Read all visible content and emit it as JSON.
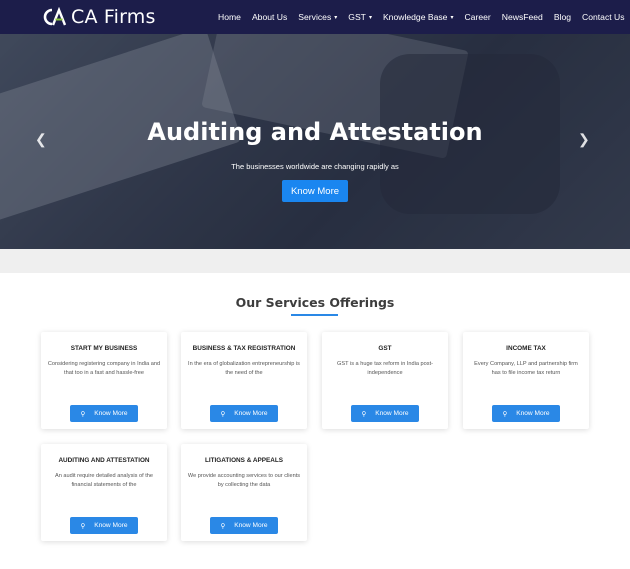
{
  "brand": {
    "name": "CA Firms",
    "logo_letters": "CA"
  },
  "nav": [
    {
      "label": "Home",
      "caret": false
    },
    {
      "label": "About Us",
      "caret": false
    },
    {
      "label": "Services",
      "caret": true
    },
    {
      "label": "GST",
      "caret": true
    },
    {
      "label": "Knowledge Base",
      "caret": true
    },
    {
      "label": "Career",
      "caret": false
    },
    {
      "label": "NewsFeed",
      "caret": false
    },
    {
      "label": "Blog",
      "caret": false
    },
    {
      "label": "Contact Us",
      "caret": false
    }
  ],
  "hero": {
    "title": "Auditing and Attestation",
    "subtitle": "The businesses worldwide are changing rapidly as",
    "button": "Know More",
    "prev_icon": "chevron-left-icon",
    "next_icon": "chevron-right-icon"
  },
  "services": {
    "heading": "Our Services Offerings",
    "accent": "#2a88e6",
    "cards": [
      {
        "title": "START MY BUSINESS",
        "text": "Considering registering company in India and that too in a fast and hassle-free",
        "button": "Know More"
      },
      {
        "title": "BUSINESS & TAX REGISTRATION",
        "text": "In the era of globalization entrepreneurship is the need of the",
        "button": "Know More"
      },
      {
        "title": "GST",
        "text": "GST is a huge tax reform in India post-independence",
        "button": "Know More"
      },
      {
        "title": "INCOME TAX",
        "text": "Every Company, LLP and partnership firm has to file income tax return",
        "button": "Know More"
      },
      {
        "title": "AUDITING AND ATTESTATION",
        "text": "An audit require detailed analysis of the financial statements of the",
        "button": "Know More"
      },
      {
        "title": "LITIGATIONS & APPEALS",
        "text": "We provide accounting services to our clients by collecting the data",
        "button": "Know More"
      }
    ]
  },
  "colors": {
    "header_bg": "#1c1d4a",
    "button_blue": "#1a86f0",
    "band_grey": "#efefef"
  }
}
